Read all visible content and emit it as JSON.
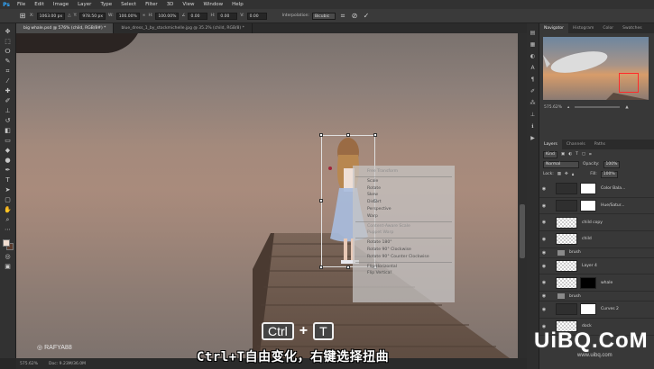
{
  "menu": {
    "logo": "Ps",
    "items": [
      "File",
      "Edit",
      "Image",
      "Layer",
      "Type",
      "Select",
      "Filter",
      "3D",
      "View",
      "Window",
      "Help"
    ]
  },
  "options": {
    "x_label": "X:",
    "x_value": "1063.00 px",
    "y_label": "Y:",
    "y_value": "978.50 px",
    "w_label": "W:",
    "w_value": "100.00%",
    "h_label": "H:",
    "h_value": "100.00%",
    "angle_value": "0.00",
    "hskew_label": "H:",
    "hskew_value": "0.00",
    "vskew_label": "V:",
    "vskew_value": "0.00",
    "interp_label": "Interpolation:",
    "interp_value": "Bicubic"
  },
  "tabs": [
    {
      "label": "big whale.psd @ 576% (child, RGB/8#) *",
      "active": true
    },
    {
      "label": "blue_dress_1_by_stockmichelle.jpg @ 35.2% (child, RGB/8) *",
      "active": false
    }
  ],
  "context_menu": {
    "items": [
      {
        "label": "Free Transform",
        "dim": true
      },
      {
        "sep": true
      },
      {
        "label": "Scale",
        "dim": false
      },
      {
        "label": "Rotate",
        "dim": false
      },
      {
        "label": "Skew",
        "dim": false
      },
      {
        "label": "Distort",
        "dim": false
      },
      {
        "label": "Perspective",
        "dim": false
      },
      {
        "label": "Warp",
        "dim": false
      },
      {
        "sep": true
      },
      {
        "label": "Content-Aware Scale",
        "dim": true
      },
      {
        "label": "Puppet Warp",
        "dim": true
      },
      {
        "sep": true
      },
      {
        "label": "Rotate 180°",
        "dim": false
      },
      {
        "label": "Rotate 90° Clockwise",
        "dim": false
      },
      {
        "label": "Rotate 90° Counter Clockwise",
        "dim": false
      },
      {
        "sep": true
      },
      {
        "label": "Flip Horizontal",
        "dim": false
      },
      {
        "label": "Flip Vertical",
        "dim": false
      }
    ]
  },
  "keys": {
    "ctrl": "Ctrl",
    "plus": "+",
    "t": "T"
  },
  "watermark": "RAFYA88",
  "subtitle": "Ctrl+T自由变化，右键选择扭曲",
  "site_logo": "UiBQ.CoM",
  "site_url": "www.uibq.com",
  "status": {
    "zoom": "575.62%",
    "doc": "Doc: 9.23M/36.0M"
  },
  "nav_panel": {
    "tabs": [
      {
        "label": "Navigator",
        "active": true
      },
      {
        "label": "Histogram",
        "active": false
      },
      {
        "label": "Color",
        "active": false
      },
      {
        "label": "Swatches",
        "active": false
      }
    ],
    "zoom": "575.62%"
  },
  "layers_panel": {
    "tabs": [
      {
        "label": "Layers",
        "active": true
      },
      {
        "label": "Channels",
        "active": false
      },
      {
        "label": "Paths",
        "active": false
      }
    ],
    "kind": "Kind",
    "blend": "Normal",
    "opacity_label": "Opacity:",
    "opacity": "100%",
    "lock_label": "Lock:",
    "fill_label": "Fill:",
    "fill": "100%",
    "layers": [
      {
        "name": "Color Bala...",
        "type": "adj"
      },
      {
        "name": "Hue/Satur...",
        "type": "adj"
      },
      {
        "name": "child copy",
        "type": "pixel"
      },
      {
        "name": "child",
        "type": "pixel"
      },
      {
        "name": "brush",
        "type": "group"
      },
      {
        "name": "Layer 4",
        "type": "pixel"
      },
      {
        "name": "whale",
        "type": "masked"
      },
      {
        "name": "brush",
        "type": "group"
      },
      {
        "name": "Curves 2",
        "type": "adj"
      },
      {
        "name": "dock",
        "type": "pixel"
      }
    ]
  }
}
